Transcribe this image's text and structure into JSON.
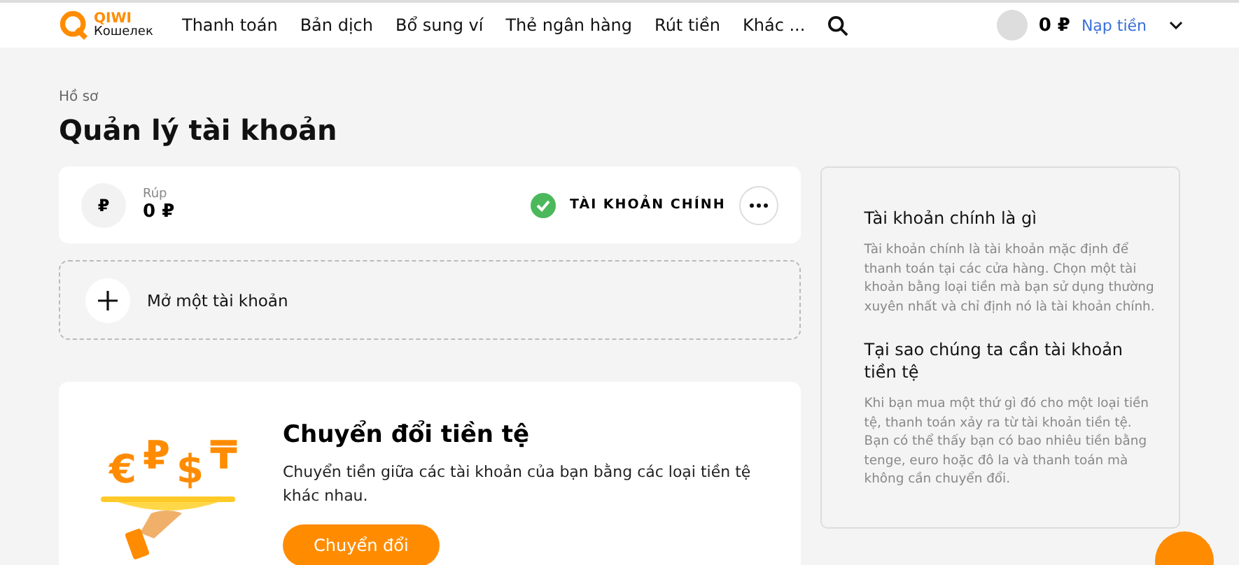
{
  "header": {
    "logo": {
      "word": "QIWI",
      "sub": "Кошелек"
    },
    "nav": [
      "Thanh toán",
      "Bản dịch",
      "Bổ sung ví",
      "Thẻ ngân hàng",
      "Rút tiền",
      "Khác ..."
    ],
    "balance": "0 ₽",
    "topup": "Nạp tiền"
  },
  "breadcrumb": "Hồ sơ",
  "title": "Quản lý tài khoản",
  "accounts": [
    {
      "symbol": "₽",
      "name": "Rúp",
      "amount": "0 ₽",
      "main": true,
      "main_label": "TÀI KHOẢN CHÍNH"
    }
  ],
  "open_account": "Mở một tài khoản",
  "convert": {
    "symbols": [
      "€",
      "₽",
      "$",
      "₸"
    ],
    "title": "Chuyển đổi tiền tệ",
    "text": "Chuyển tiền giữa các tài khoản của bạn bằng các loại tiền tệ khác nhau.",
    "button": "Chuyển đổi"
  },
  "info": [
    {
      "title": "Tài khoản chính là gì",
      "text": "Tài khoản chính là tài khoản mặc định để thanh toán tại các cửa hàng. Chọn một tài khoản bằng loại tiền mà bạn sử dụng thường xuyên nhất và chỉ định nó là tài khoản chính."
    },
    {
      "title": "Tại sao chúng ta cần tài khoản tiền tệ",
      "text": "Khi bạn mua một thứ gì đó cho một loại tiền tệ, thanh toán xảy ra từ tài khoản tiền tệ. Bạn có thể thấy bạn có bao nhiêu tiền bằng tenge, euro hoặc đô la và thanh toán mà không cần chuyển đổi."
    }
  ]
}
